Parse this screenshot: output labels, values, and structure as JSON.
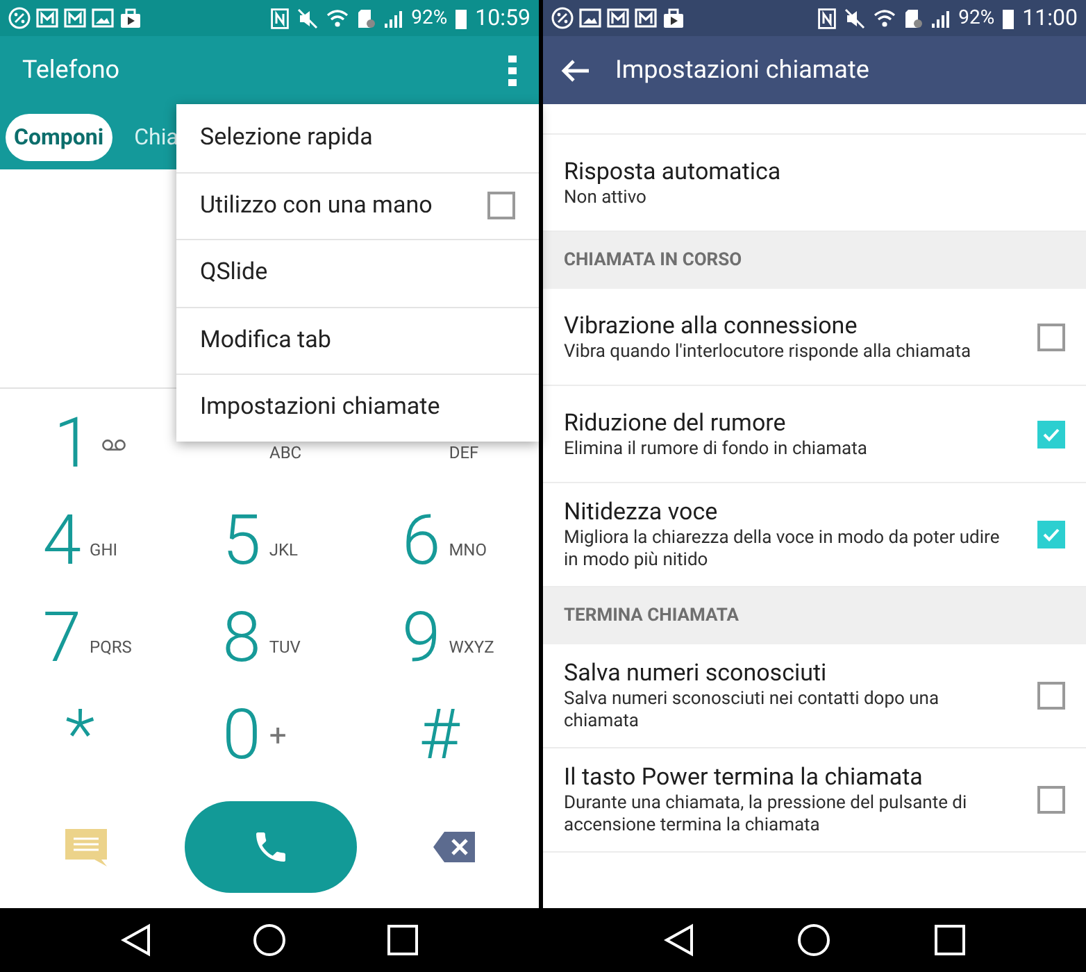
{
  "left_screen": {
    "status_bar": {
      "battery": "92%",
      "time": "10:59"
    },
    "app_bar": {
      "title": "Telefono"
    },
    "tabs": [
      {
        "label": "Componi",
        "selected": true
      },
      {
        "label": "Chia",
        "selected": false
      }
    ],
    "keypad": [
      {
        "digit": "1",
        "kind": "voicemail"
      },
      {
        "kind": "letters",
        "letters": "ABC"
      },
      {
        "kind": "letters",
        "letters": "DEF"
      },
      {
        "digit": "4",
        "kind": "letters",
        "letters": "GHI"
      },
      {
        "digit": "5",
        "kind": "letters",
        "letters": "JKL"
      },
      {
        "digit": "6",
        "kind": "letters",
        "letters": "MNO"
      },
      {
        "digit": "7",
        "kind": "letters",
        "letters": "PQRS"
      },
      {
        "digit": "8",
        "kind": "letters",
        "letters": "TUV"
      },
      {
        "digit": "9",
        "kind": "letters",
        "letters": "WXYZ"
      },
      {
        "digit": "*",
        "kind": "symbol"
      },
      {
        "digit": "0",
        "kind": "letters",
        "letters": "+"
      },
      {
        "digit": "#",
        "kind": "symbol"
      }
    ],
    "menu": [
      {
        "label": "Selezione rapida",
        "kind": "plain"
      },
      {
        "label": "Utilizzo con una mano",
        "kind": "checkbox",
        "checked": false
      },
      {
        "label": "QSlide",
        "kind": "plain"
      },
      {
        "label": "Modifica tab",
        "kind": "plain"
      },
      {
        "label": "Impostazioni chiamate",
        "kind": "plain"
      }
    ]
  },
  "right_screen": {
    "status_bar": {
      "battery": "92%",
      "time": "11:00"
    },
    "app_bar": {
      "title": "Impostazioni chiamate"
    },
    "settings": [
      {
        "kind": "item",
        "title": "Risposta automatica",
        "summary": "Non attivo"
      },
      {
        "kind": "header",
        "title": "CHIAMATA IN CORSO"
      },
      {
        "kind": "check",
        "title": "Vibrazione alla connessione",
        "summary": "Vibra quando l'interlocutore risponde alla chiamata",
        "checked": false
      },
      {
        "kind": "check",
        "title": "Riduzione del rumore",
        "summary": "Elimina il rumore di fondo in chiamata",
        "checked": true
      },
      {
        "kind": "check",
        "title": "Nitidezza voce",
        "summary": "Migliora la chiarezza della voce in modo da poter udire in modo più nitido",
        "checked": true
      },
      {
        "kind": "header",
        "title": "TERMINA CHIAMATA"
      },
      {
        "kind": "check",
        "title": "Salva numeri sconosciuti",
        "summary": "Salva numeri sconosciuti nei contatti dopo una chiamata",
        "checked": false
      },
      {
        "kind": "check",
        "title": "Il tasto Power termina la chiamata",
        "summary": "Durante una chiamata, la pressione del pulsante di accensione termina la chiamata",
        "checked": false
      }
    ]
  }
}
